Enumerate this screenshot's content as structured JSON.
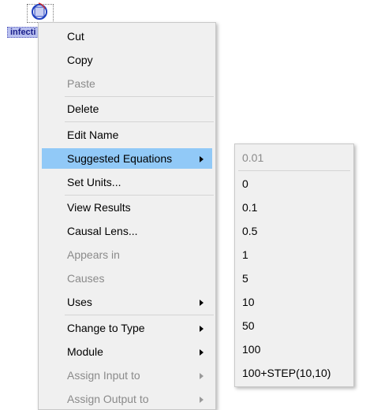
{
  "node": {
    "label": "infecti"
  },
  "context_menu": {
    "items": [
      {
        "label": "Cut",
        "enabled": true
      },
      {
        "label": "Copy",
        "enabled": true
      },
      {
        "label": "Paste",
        "enabled": false
      },
      {
        "label": "Delete",
        "enabled": true
      },
      {
        "label": "Edit Name",
        "enabled": true
      },
      {
        "label": "Suggested Equations",
        "enabled": true,
        "highlighted": true,
        "has_submenu": true
      },
      {
        "label": "Set Units...",
        "enabled": true
      },
      {
        "label": "View Results",
        "enabled": true
      },
      {
        "label": "Causal Lens...",
        "enabled": true
      },
      {
        "label": "Appears in",
        "enabled": false
      },
      {
        "label": "Causes",
        "enabled": false
      },
      {
        "label": "Uses",
        "enabled": true,
        "has_submenu": true
      },
      {
        "label": "Change to Type",
        "enabled": true,
        "has_submenu": true
      },
      {
        "label": "Module",
        "enabled": true,
        "has_submenu": true
      },
      {
        "label": "Assign Input to",
        "enabled": false,
        "has_submenu": true
      },
      {
        "label": "Assign Output to",
        "enabled": false,
        "has_submenu": true
      }
    ]
  },
  "submenu": {
    "items": [
      {
        "label": "0.01",
        "enabled": false
      },
      {
        "label": "0",
        "enabled": true
      },
      {
        "label": "0.1",
        "enabled": true
      },
      {
        "label": "0.5",
        "enabled": true
      },
      {
        "label": "1",
        "enabled": true
      },
      {
        "label": "5",
        "enabled": true
      },
      {
        "label": "10",
        "enabled": true
      },
      {
        "label": "50",
        "enabled": true
      },
      {
        "label": "100",
        "enabled": true
      },
      {
        "label": "100+STEP(10,10)",
        "enabled": true
      }
    ]
  },
  "colors": {
    "highlight": "#91c9f7",
    "menu_bg": "#f0f0f0",
    "disabled_text": "#8a8a8a"
  }
}
